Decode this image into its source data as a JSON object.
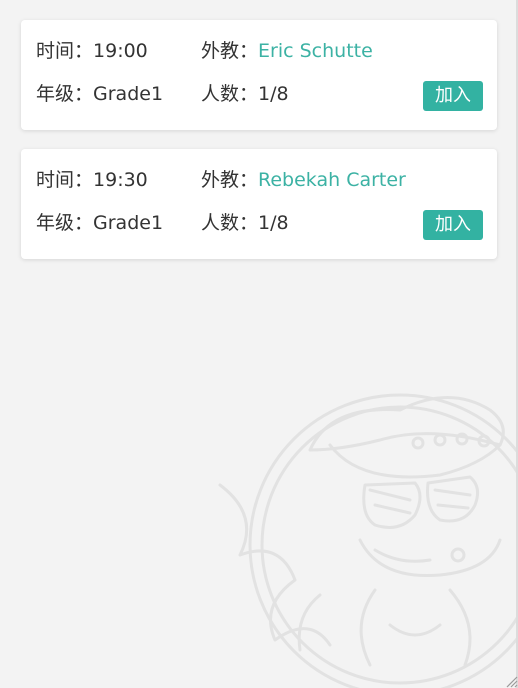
{
  "sessions": [
    {
      "time_label": "时间：",
      "time": "19:00",
      "teacher_label": "外教：",
      "teacher": "Eric Schutte",
      "grade_label": "年级：",
      "grade": "Grade1",
      "count_label": "人数：",
      "count": "1/8",
      "join_label": "加入"
    },
    {
      "time_label": "时间：",
      "time": "19:30",
      "teacher_label": "外教：",
      "teacher": "Rebekah Carter",
      "grade_label": "年级：",
      "grade": "Grade1",
      "count_label": "人数：",
      "count": "1/8",
      "join_label": "加入"
    }
  ],
  "colors": {
    "accent": "#33b2a2",
    "teacher_name": "#3cb2a4",
    "background": "#f3f3f3",
    "card": "#ffffff",
    "text": "#333333"
  },
  "icons": {
    "watermark": "cartoon-mascot-icon",
    "resize": "resize-grip-icon"
  }
}
